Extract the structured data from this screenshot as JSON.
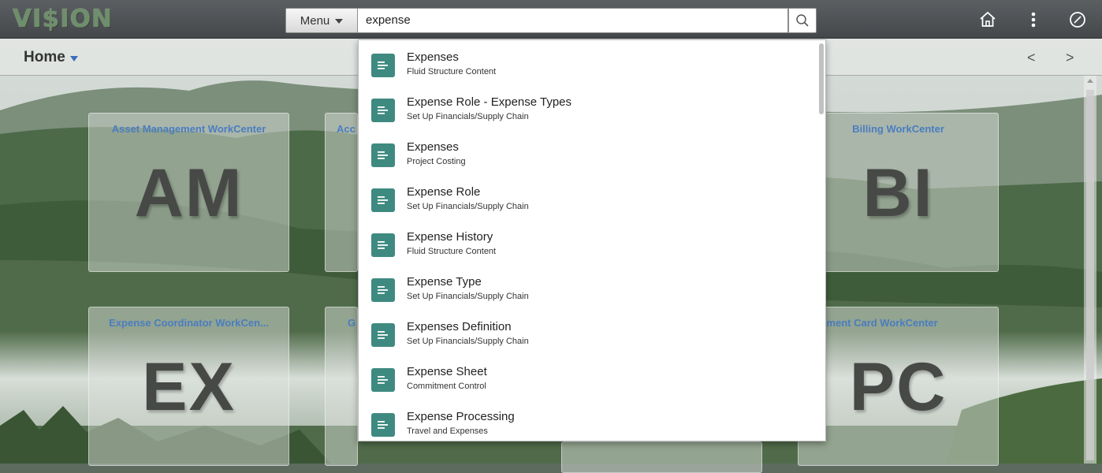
{
  "header": {
    "logo_text": "VI$ION",
    "menu_label": "Menu",
    "search_value": "expense",
    "icons": [
      "search-icon",
      "home-icon",
      "more-vertical-icon",
      "navbar-compass-icon"
    ]
  },
  "subheader": {
    "title": "Home",
    "prev": "<",
    "next": ">"
  },
  "tiles": [
    {
      "title": "Asset Management WorkCenter",
      "abbr": "AM"
    },
    {
      "title": "Acc",
      "abbr": ""
    },
    {
      "title": "Billing WorkCenter",
      "abbr": "BI"
    },
    {
      "title": "Expense Coordinator WorkCen...",
      "abbr": "EX"
    },
    {
      "title": "G",
      "abbr": ""
    },
    {
      "title": "ocurement Card WorkCenter",
      "abbr": "PC"
    }
  ],
  "search_results": [
    {
      "title": "Expenses",
      "subtitle": "Fluid Structure Content"
    },
    {
      "title": "Expense Role - Expense Types",
      "subtitle": "Set Up Financials/Supply Chain"
    },
    {
      "title": "Expenses",
      "subtitle": "Project Costing"
    },
    {
      "title": "Expense Role",
      "subtitle": "Set Up Financials/Supply Chain"
    },
    {
      "title": "Expense History",
      "subtitle": "Fluid Structure Content"
    },
    {
      "title": "Expense Type",
      "subtitle": "Set Up Financials/Supply Chain"
    },
    {
      "title": "Expenses Definition",
      "subtitle": "Set Up Financials/Supply Chain"
    },
    {
      "title": "Expense Sheet",
      "subtitle": "Commitment Control"
    },
    {
      "title": "Expense Processing",
      "subtitle": "Travel and Expenses"
    }
  ],
  "colors": {
    "result_icon": "#3f8a80",
    "tile_title": "#4a7dc0",
    "header": "#4e5255"
  }
}
